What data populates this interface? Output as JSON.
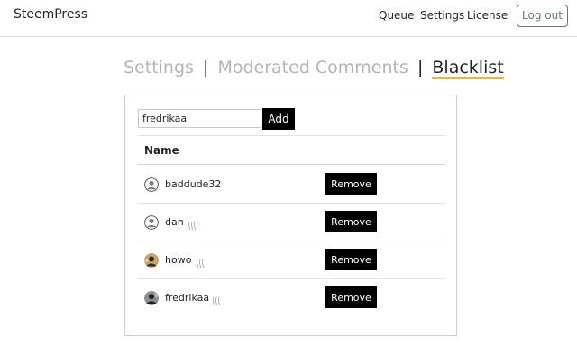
{
  "navbar": {
    "brand": "SteemPress",
    "links": [
      "Queue",
      "Settings",
      "License"
    ],
    "logout_label": "Log out"
  },
  "tabs": {
    "items": [
      "Settings",
      "Moderated Comments",
      "Blacklist"
    ],
    "separator": "|",
    "active": "Blacklist"
  },
  "blacklist": {
    "input_value": "fredrikaa",
    "add_label": "Add",
    "column_header": "Name",
    "remove_label": "Remove",
    "rows": [
      {
        "username": "baddude32",
        "avatar": "default-avatar-icon",
        "steem_icon": false
      },
      {
        "username": "dan",
        "avatar": "default-avatar-icon",
        "steem_icon": true
      },
      {
        "username": "howo",
        "avatar": "photo-avatar-icon",
        "steem_icon": true
      },
      {
        "username": "fredrikaa",
        "avatar": "photo-avatar-icon",
        "steem_icon": true
      }
    ]
  },
  "colors": {
    "accent_underline": "#f2b330",
    "button_bg": "#000000",
    "inactive_tab": "#b4b4b4"
  }
}
